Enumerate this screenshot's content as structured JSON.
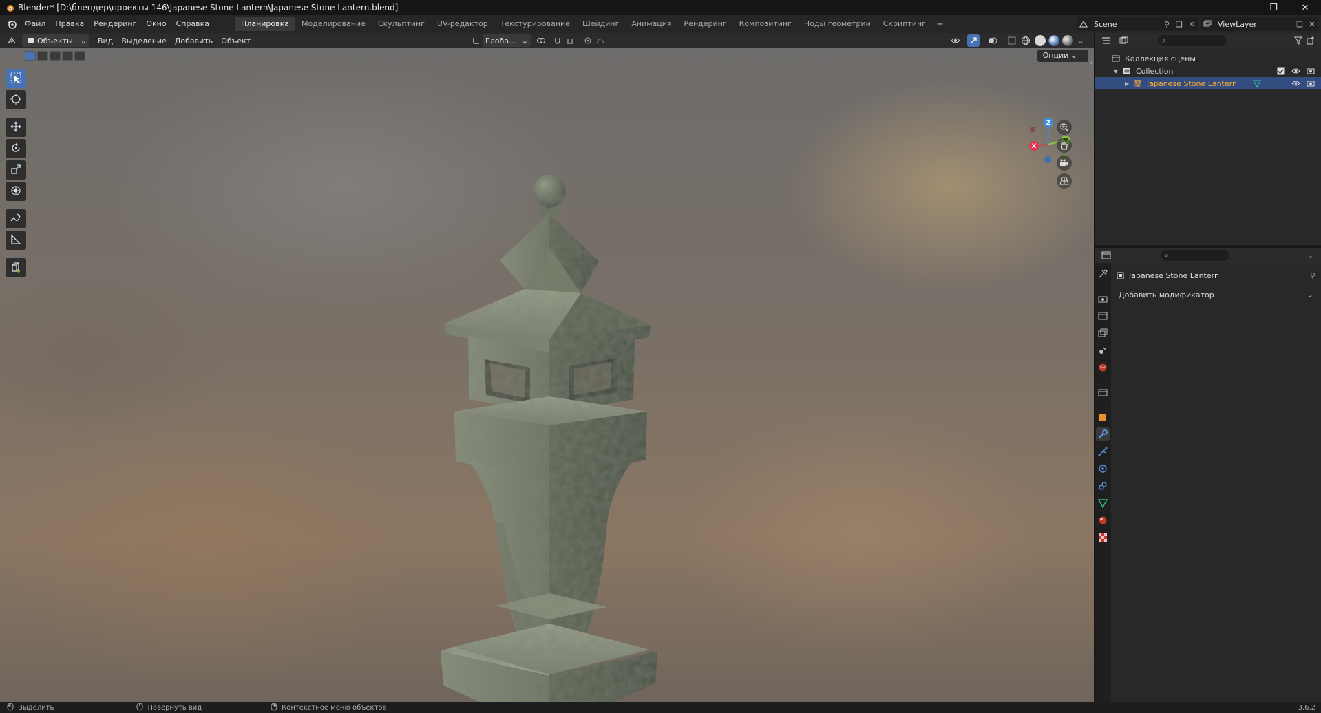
{
  "window": {
    "title": "Blender* [D:\\блендер\\проекты 146\\Japanese Stone Lantern\\Japanese Stone Lantern.blend]",
    "minimize": "—",
    "maximize": "❐",
    "close": "✕"
  },
  "menu": {
    "items": [
      "Файл",
      "Правка",
      "Рендеринг",
      "Окно",
      "Справка"
    ],
    "workspaces": [
      "Планировка",
      "Моделирование",
      "Скульптинг",
      "UV-редактор",
      "Текстурирование",
      "Шейдинг",
      "Анимация",
      "Рендеринг",
      "Композитинг",
      "Ноды геометрии",
      "Скриптинг"
    ],
    "active_workspace": "Планировка",
    "add_workspace": "+",
    "scene": "Scene",
    "view_layer": "ViewLayer"
  },
  "viewport_header": {
    "mode": "Объекты",
    "menus": [
      "Вид",
      "Выделение",
      "Добавить",
      "Объект"
    ],
    "transform_orientation": "Глоба...",
    "options": "Опции"
  },
  "gizmo": {
    "z": "Z",
    "y": "Y",
    "x": "X"
  },
  "outliner": {
    "root": "Коллекция сцены",
    "collection": "Collection",
    "object": "Japanese Stone Lantern"
  },
  "properties": {
    "object_name": "Japanese Stone Lantern",
    "add_modifier": "Добавить модификатор",
    "active_tab": "wrench-icon"
  },
  "statusbar": {
    "select": "Выделить",
    "rotate_view": "Повернуть вид",
    "context_menu": "Контекстное меню объектов",
    "version": "3.6.2"
  },
  "colors": {
    "accent": "#4772b3",
    "selected_text": "#ffaf29",
    "axis_x": "#e3334d",
    "axis_y": "#8bc43f",
    "axis_z": "#3c8fe0"
  }
}
